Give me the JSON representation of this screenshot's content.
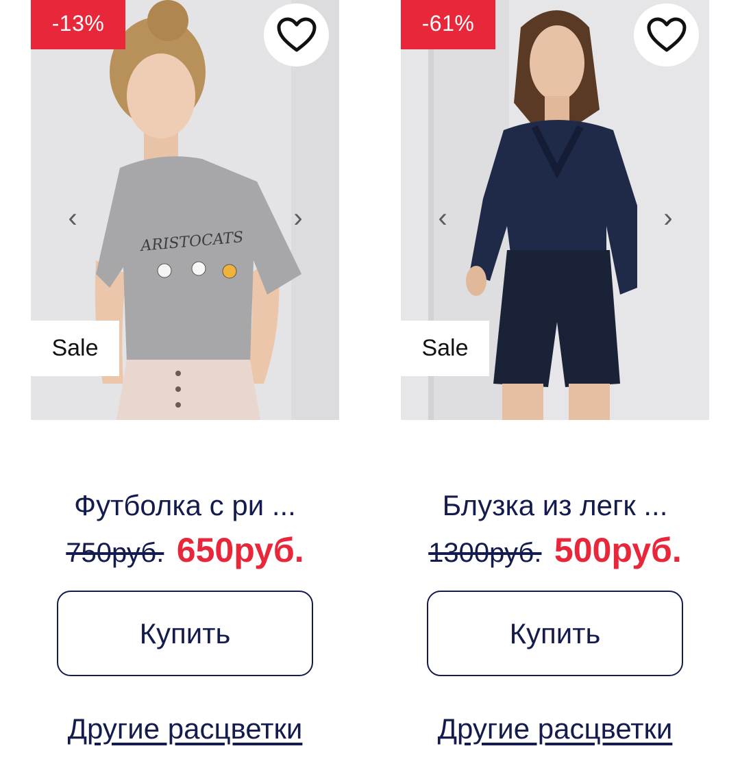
{
  "products": [
    {
      "discount": "-13%",
      "badge": "Sale",
      "image": "grey-aristocats-tshirt-photo",
      "print_text": "ARISTOCATS",
      "title": "Футболка с ри ...",
      "old_price": "750руб.",
      "new_price": "650руб.",
      "buy_label": "Купить",
      "other_colors_label": "Другие расцветки",
      "prev_arrow": "‹",
      "next_arrow": "›"
    },
    {
      "discount": "-61%",
      "badge": "Sale",
      "image": "navy-blouse-shorts-photo",
      "title": "Блузка из легк ...",
      "old_price": "1300руб.",
      "new_price": "500руб.",
      "buy_label": "Купить",
      "other_colors_label": "Другие расцветки",
      "prev_arrow": "‹",
      "next_arrow": "›"
    }
  ],
  "colors": {
    "accent_red": "#e8283a",
    "text_navy": "#141b4d",
    "photo_bg": "#e6e6e8"
  },
  "icons": {
    "favorite": "heart-outline-icon",
    "prev": "chevron-left-icon",
    "next": "chevron-right-icon"
  }
}
